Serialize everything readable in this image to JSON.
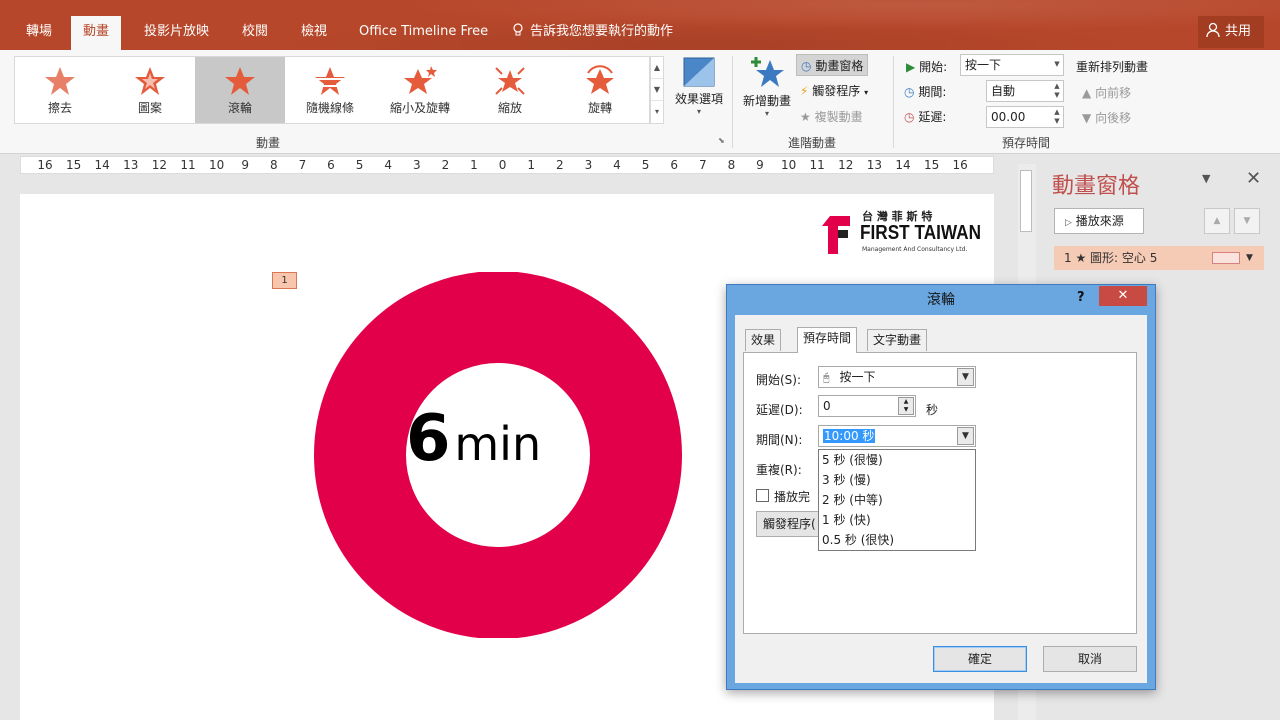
{
  "tabs": [
    "轉場",
    "動畫",
    "投影片放映",
    "校閱",
    "檢視",
    "Office Timeline Free"
  ],
  "active_tab": "動畫",
  "tell_me": "告訴我您想要執行的動作",
  "share": "共用",
  "gallery": {
    "items": [
      "擦去",
      "圖案",
      "滾輪",
      "隨機線條",
      "縮小及旋轉",
      "縮放",
      "旋轉"
    ],
    "selected": "滾輪"
  },
  "effect_options": "效果選項",
  "group_animation": "動畫",
  "add_animation": "新增動畫",
  "animation_pane_btn": "動畫窗格",
  "trigger_btn": "觸發程序",
  "painter_btn": "複製動畫",
  "group_advanced": "進階動畫",
  "timing": {
    "start_label": "開始:",
    "start_value": "按一下",
    "duration_label": "期間:",
    "duration_value": "自動",
    "delay_label": "延遲:",
    "delay_value": "00.00",
    "group": "預存時間"
  },
  "reorder": {
    "title": "重新排列動畫",
    "earlier": "向前移",
    "later": "向後移"
  },
  "ruler": [
    "16",
    "15",
    "14",
    "13",
    "12",
    "11",
    "10",
    "9",
    "8",
    "7",
    "6",
    "5",
    "4",
    "3",
    "2",
    "1",
    "0",
    "1",
    "2",
    "3",
    "4",
    "5",
    "6",
    "7",
    "8",
    "9",
    "10",
    "11",
    "12",
    "13",
    "14",
    "15",
    "16"
  ],
  "slide": {
    "tag": "1",
    "center_number": "6",
    "center_unit": "min",
    "ring_color": "#e2004b",
    "logo": {
      "top": "台 灣 菲 斯 特",
      "main": "FIRST TAIWAN",
      "sub": "Management And Consultancy Ltd."
    }
  },
  "pane": {
    "title": "動畫窗格",
    "play": "播放來源",
    "item": "1 ★ 圖形: 空心 5"
  },
  "dialog": {
    "title": "滾輪",
    "help": "?",
    "tabs": [
      "效果",
      "預存時間",
      "文字動畫"
    ],
    "active_tab": "預存時間",
    "start_label": "開始(S):",
    "start_value": "按一下",
    "delay_label": "延遲(D):",
    "delay_value": "0",
    "delay_unit": "秒",
    "duration_label": "期間(N):",
    "duration_value": "10:00 秒",
    "repeat_label": "重複(R):",
    "rewind_label": "播放完",
    "triggers_btn": "觸發程序(",
    "duration_options": [
      "5 秒 (很慢)",
      "3 秒 (慢)",
      "2 秒 (中等)",
      "1 秒 (快)",
      "0.5 秒 (很快)"
    ],
    "ok": "確定",
    "cancel": "取消"
  }
}
